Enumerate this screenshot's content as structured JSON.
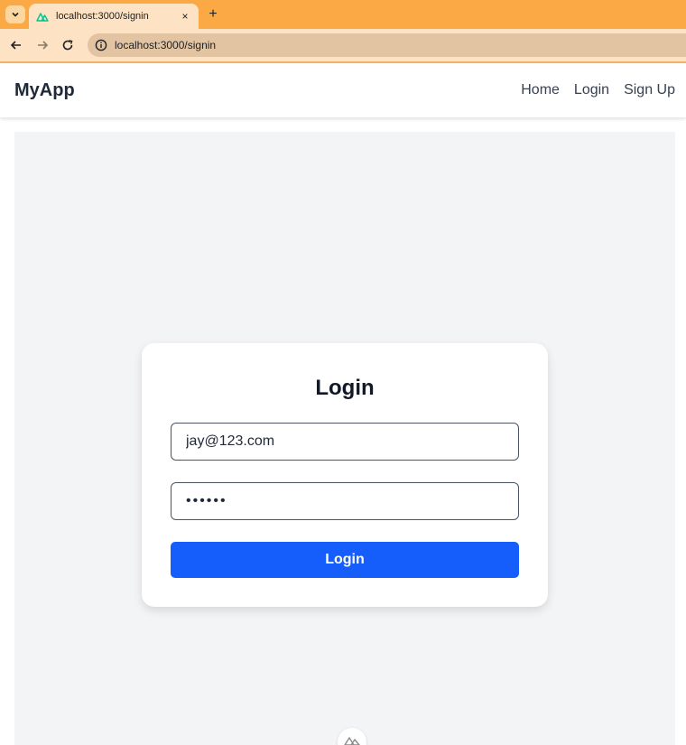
{
  "browser": {
    "tab_title": "localhost:3000/signin",
    "tab_close": "×",
    "new_tab": "+",
    "url": "localhost:3000/signin"
  },
  "app": {
    "brand": "MyApp",
    "nav": [
      {
        "label": "Home"
      },
      {
        "label": "Login"
      },
      {
        "label": "Sign Up"
      }
    ]
  },
  "login_form": {
    "title": "Login",
    "email_value": "jay@123.com",
    "password_value": "123456",
    "submit_label": "Login"
  },
  "colors": {
    "tabbar": "#fba944",
    "primary_button": "#155efc",
    "page_background": "#f3f4f6"
  }
}
